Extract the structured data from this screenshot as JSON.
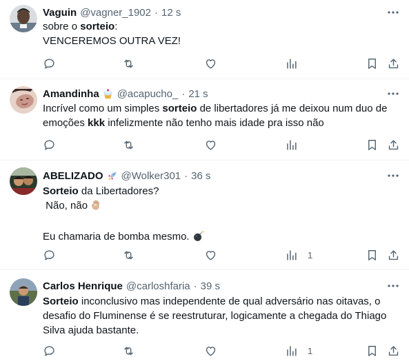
{
  "tweets": [
    {
      "name": "Vaguin",
      "handle": "@vagner_1902",
      "time": "12 s",
      "emoji": "",
      "lines": [
        {
          "pre": "sobre o ",
          "bold": "sorteio",
          "post": ":"
        },
        {
          "pre": "VENCEREMOS OUTRA VEZ!",
          "bold": "",
          "post": ""
        }
      ],
      "views_count": "",
      "avatar_color": "#6b5a4e"
    },
    {
      "name": "Amandinha",
      "handle": "@acapucho_",
      "time": "21 s",
      "emoji": "cupcake-emoji",
      "lines": [
        {
          "pre": "Incrível como um simples ",
          "bold": "sorteio",
          "post": " de libertadores já me deixou num duo de"
        },
        {
          "pre": "emoções ",
          "bold": "kkk",
          "post": " infelizmente não tenho mais idade pra isso não"
        }
      ],
      "views_count": "",
      "avatar_color": "#c9a79c"
    },
    {
      "name": "ABELIZADO",
      "handle": "@Wolker301",
      "time": "36 s",
      "emoji": "rocket-emoji",
      "lines": [
        {
          "pre": "",
          "bold": "Sorteio",
          "post": " da Libertadores?"
        },
        {
          "pre": " Não, não",
          "bold": "",
          "post": ""
        },
        {
          "pre": "",
          "bold": "",
          "post": ""
        },
        {
          "pre": "Eu chamaria de bomba mesmo.",
          "bold": "",
          "post": ""
        }
      ],
      "views_count": "1",
      "avatar_color": "#3b4a3a"
    },
    {
      "name": "Carlos Henrique",
      "handle": "@carloshfaria",
      "time": "39 s",
      "emoji": "",
      "lines": [
        {
          "pre": "",
          "bold": "Sorteio",
          "post": " inconclusivo mas independente de qual adversário nas oitavas, o"
        },
        {
          "pre": "desafio do Fluminense é se reestruturar, logicamente a chegada do Thiago",
          "bold": "",
          "post": ""
        },
        {
          "pre": "Silva ajuda bastante.",
          "bold": "",
          "post": ""
        }
      ],
      "views_count": "1",
      "avatar_color": "#5d7048"
    }
  ]
}
